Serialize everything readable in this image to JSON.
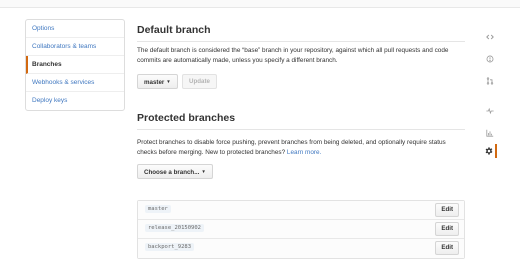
{
  "settings_menu": {
    "items": [
      {
        "label": "Options"
      },
      {
        "label": "Collaborators & teams"
      },
      {
        "label": "Branches",
        "selected": true
      },
      {
        "label": "Webhooks & services"
      },
      {
        "label": "Deploy keys"
      }
    ]
  },
  "default_branch": {
    "title": "Default branch",
    "description": "The default branch is considered the “base” branch in your repository, against which all pull requests and code commits are automatically made, unless you specify a different branch.",
    "selected_branch": "master",
    "update_label": "Update"
  },
  "protected_branches": {
    "title": "Protected branches",
    "description": "Protect branches to disable force pushing, prevent branches from being deleted, and optionally require status checks before merging. New to protected branches?",
    "learn_more": "Learn more.",
    "choose_label": "Choose a branch...",
    "edit_label": "Edit",
    "branches": [
      {
        "name": "master"
      },
      {
        "name": "release_20150902"
      },
      {
        "name": "backport_9283"
      }
    ]
  },
  "repo_nav": {
    "icons": [
      "code-icon",
      "issues-icon",
      "pull-requests-icon",
      "pulse-icon",
      "graphs-icon",
      "settings-icon"
    ],
    "selected": "settings-icon",
    "accent_color": "#d26911"
  }
}
